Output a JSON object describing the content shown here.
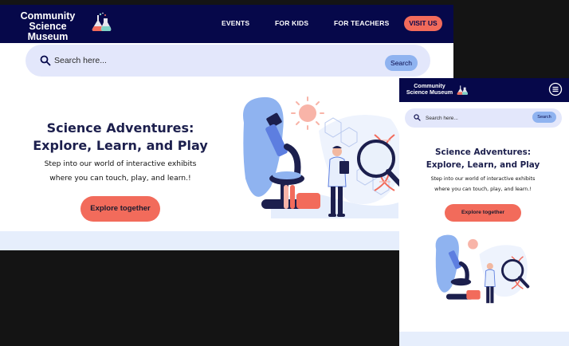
{
  "brand": {
    "line1": "Community",
    "line2": "Science Museum"
  },
  "nav": {
    "events": "EVENTS",
    "for_kids": "FOR KIDS",
    "for_teachers": "FOR TEACHERS",
    "visit_us": "VISIT US"
  },
  "search": {
    "placeholder": "Search here...",
    "button": "Search"
  },
  "hero": {
    "title_line1": "Science Adventures:",
    "title_line2": "Explore, Learn, and Play",
    "subtitle_line1": "Step into our world of interactive exhibits",
    "subtitle_line2": "where you can touch, play, and learn.!",
    "cta": "Explore together"
  },
  "colors": {
    "navy": "#06084a",
    "coral": "#f26b5b",
    "search_bg": "#e3e7fb",
    "search_button": "#8fb3f0",
    "band": "#e6eefc",
    "backdrop": "#141414"
  },
  "icons": {
    "logo": "flask-beakers-icon",
    "search": "search-icon",
    "menu": "hamburger-menu-icon"
  }
}
